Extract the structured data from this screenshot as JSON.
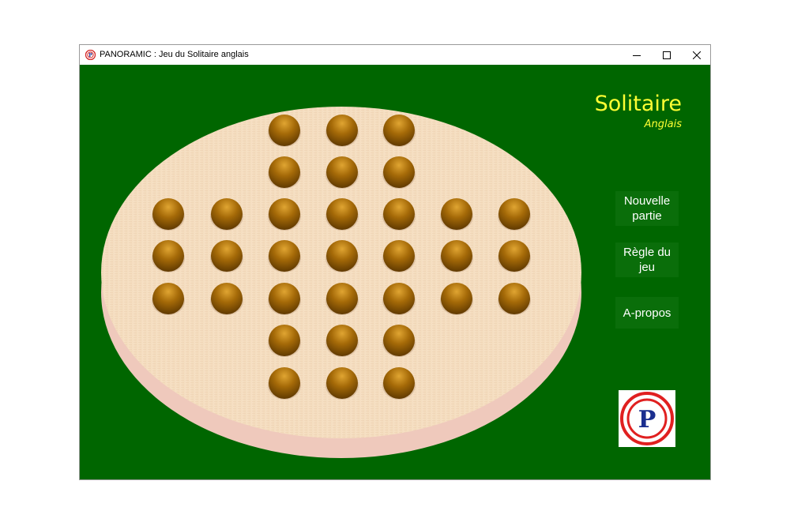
{
  "window": {
    "title": "PANORAMIC : Jeu du Solitaire anglais",
    "controls": {
      "minimize_icon": "minimize-icon",
      "maximize_icon": "maximize-icon",
      "close_icon": "close-icon"
    }
  },
  "game": {
    "title": "Solitaire",
    "subtitle": "Anglais",
    "board": {
      "layout": "english-cross",
      "rows": [
        [
          0,
          0,
          1,
          1,
          1,
          0,
          0
        ],
        [
          0,
          0,
          1,
          1,
          1,
          0,
          0
        ],
        [
          1,
          1,
          1,
          1,
          1,
          1,
          1
        ],
        [
          1,
          1,
          1,
          1,
          1,
          1,
          1
        ],
        [
          1,
          1,
          1,
          1,
          1,
          1,
          1
        ],
        [
          0,
          0,
          1,
          1,
          1,
          0,
          0
        ],
        [
          0,
          0,
          1,
          1,
          1,
          0,
          0
        ]
      ],
      "peg_count": 33
    }
  },
  "menu": {
    "new_game": "Nouvelle partie",
    "rules": "Règle du jeu",
    "about": "A-propos"
  },
  "logo": {
    "letter": "P",
    "ring_color": "#e02020",
    "letter_color": "#1a2e8f"
  },
  "colors": {
    "background": "#006600",
    "title_text": "#ffff33",
    "board_wood": "#f4dcc0",
    "board_rim": "#efc9bc",
    "peg": "#a56a08"
  }
}
